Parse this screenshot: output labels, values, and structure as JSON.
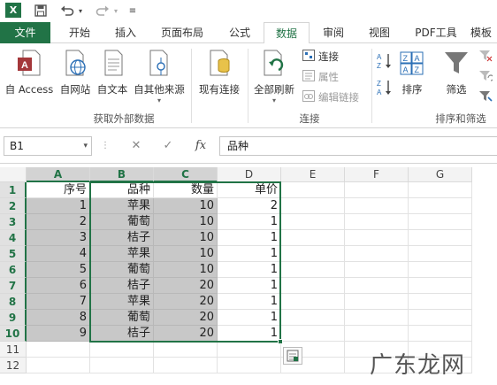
{
  "quick_access": {
    "app_icon": "excel-logo",
    "app_letter": "X",
    "save_icon": "save-icon",
    "undo_icon": "undo-icon",
    "redo_icon": "redo-icon",
    "customize_icon": "customize-icon"
  },
  "tabs": [
    {
      "label": "文件"
    },
    {
      "label": "开始"
    },
    {
      "label": "插入"
    },
    {
      "label": "页面布局"
    },
    {
      "label": "公式"
    },
    {
      "label": "数据"
    },
    {
      "label": "审阅"
    },
    {
      "label": "视图"
    },
    {
      "label": "PDF工具"
    },
    {
      "label": "模板"
    }
  ],
  "active_tab": "数据",
  "ribbon": {
    "external": {
      "buttons": [
        "自 Access",
        "自网站",
        "自文本",
        "自其他来源",
        "现有连接"
      ],
      "group_label": "获取外部数据"
    },
    "connections": {
      "refresh_label": "全部刷新",
      "small": [
        "连接",
        "属性",
        "编辑链接"
      ],
      "group_label": "连接"
    },
    "sort": {
      "sort_label": "排序",
      "filter_label": "筛选",
      "group_label": "排序和筛选"
    }
  },
  "formula_bar": {
    "name_box": "B1",
    "cancel": "✕",
    "enter": "✓",
    "fx": "fx",
    "value": "品种"
  },
  "sheet": {
    "columns": [
      "A",
      "B",
      "C",
      "D",
      "E",
      "F",
      "G"
    ],
    "rows": [
      "1",
      "2",
      "3",
      "4",
      "5",
      "6",
      "7",
      "8",
      "9",
      "10",
      "11",
      "12"
    ],
    "data": [
      [
        "序号",
        "品种",
        "数量",
        "单价"
      ],
      [
        "1",
        "苹果",
        "10",
        "2"
      ],
      [
        "2",
        "葡萄",
        "10",
        "1"
      ],
      [
        "3",
        "桔子",
        "10",
        "1"
      ],
      [
        "4",
        "苹果",
        "10",
        "1"
      ],
      [
        "5",
        "葡萄",
        "10",
        "1"
      ],
      [
        "6",
        "桔子",
        "20",
        "1"
      ],
      [
        "7",
        "苹果",
        "20",
        "1"
      ],
      [
        "8",
        "葡萄",
        "20",
        "1"
      ],
      [
        "9",
        "桔子",
        "20",
        "1"
      ]
    ],
    "selected_range": "B1:D10"
  },
  "watermark": "广东龙网",
  "colors": {
    "accent": "#217346",
    "selection_shade": "#c8c8c8"
  }
}
